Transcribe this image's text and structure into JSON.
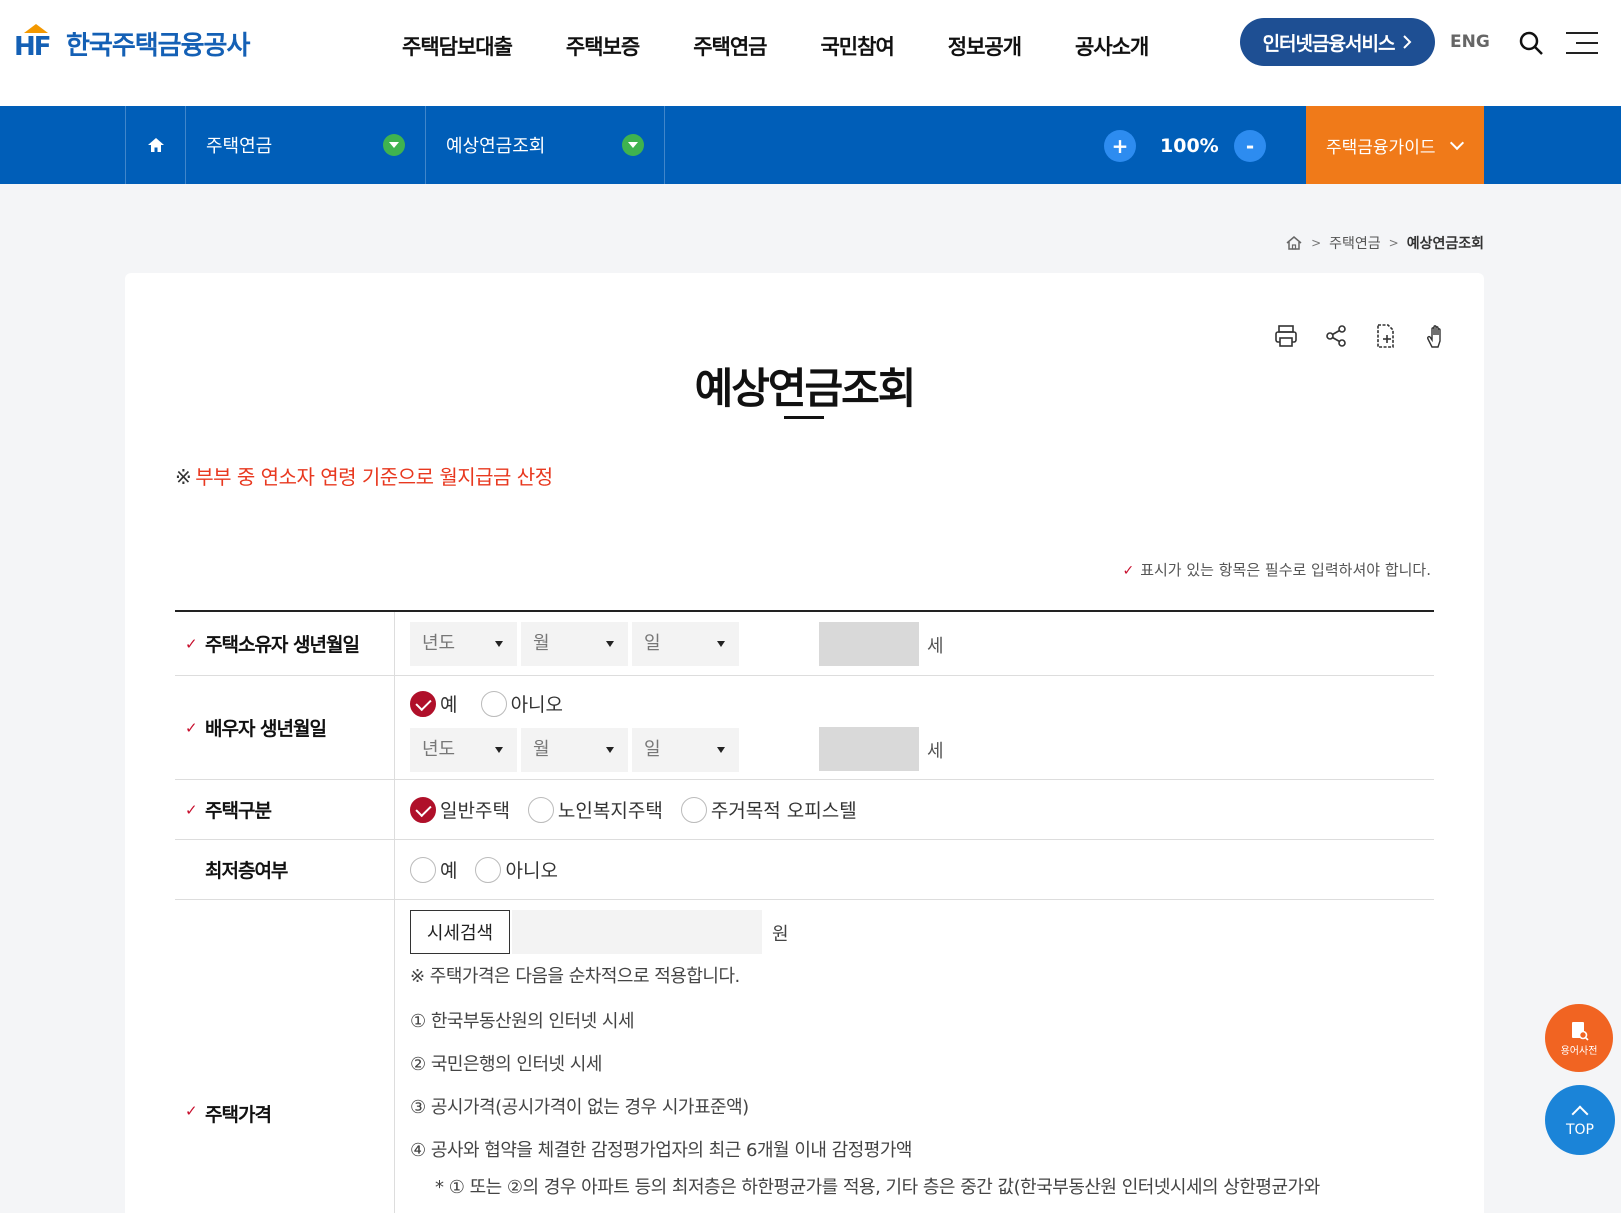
{
  "header": {
    "logo_mark": "HF",
    "logo_text": "한국주택금융공사",
    "menu": [
      "주택담보대출",
      "주택보증",
      "주택연금",
      "국민참여",
      "정보공개",
      "공사소개"
    ],
    "ibank_label": "인터넷금융서비스",
    "lang_label": "ENG"
  },
  "navbar": {
    "crumb1": "주택연금",
    "crumb2": "예상연금조회",
    "zoom": "100%",
    "zoom_in": "+",
    "zoom_out": "-",
    "guide_label": "주택금융가이드"
  },
  "location": {
    "items": [
      "주택연금",
      "예상연금조회"
    ]
  },
  "page": {
    "title": "예상연금조회",
    "notice_mark": "※",
    "notice": "부부 중 연소자 연령 기준으로 월지급금 산정",
    "required_note": "표시가 있는 항목은 필수로 입력하셔야 합니다."
  },
  "form": {
    "owner_birth": {
      "label": "주택소유자 생년월일",
      "year": "년도",
      "month": "월",
      "day": "일",
      "age_unit": "세"
    },
    "spouse_birth": {
      "label": "배우자 생년월일",
      "yes": "예",
      "no": "아니오",
      "year": "년도",
      "month": "월",
      "day": "일",
      "age_unit": "세"
    },
    "house_type": {
      "label": "주택구분",
      "options": [
        "일반주택",
        "노인복지주택",
        "주거목적 오피스텔"
      ]
    },
    "lowest_floor": {
      "label": "최저층여부",
      "yes": "예",
      "no": "아니오"
    },
    "house_price": {
      "label": "주택가격",
      "search_button": "시세검색",
      "unit": "원",
      "note": "※ 주택가격은 다음을 순차적으로 적용합니다.",
      "lines": [
        "① 한국부동산원의 인터넷 시세",
        "② 국민은행의 인터넷 시세",
        "③ 공시가격(공시가격이 없는 경우 시가표준액)",
        "④ 공사와 협약을 체결한 감정평가업자의 최근 6개월 이내 감정평가액",
        "* ① 또는 ②의 경우 아파트 등의 최저층은 하한평균가를 적용, 기타 층은 중간 값(한국부동산원 인터넷시세의 상한평균가와"
      ]
    }
  },
  "floating": {
    "dict_label": "용어사전",
    "top_label": "TOP"
  },
  "colors": {
    "brand_blue": "#005eb8",
    "accent_orange": "#f07a19",
    "check_red": "#b0102a"
  }
}
